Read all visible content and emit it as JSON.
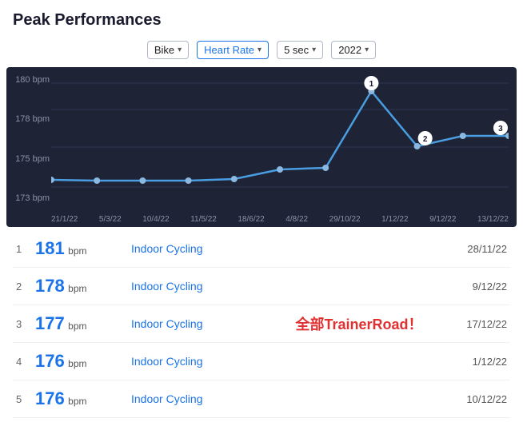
{
  "title": "Peak Performances",
  "filters": [
    {
      "label": "Bike",
      "active": false
    },
    {
      "label": "Heart Rate",
      "active": true
    },
    {
      "label": "5 sec",
      "active": false
    },
    {
      "label": "2022",
      "active": false
    }
  ],
  "chart": {
    "yLabels": [
      "180 bpm",
      "178 bpm",
      "175 bpm",
      "173 bpm"
    ],
    "xLabels": [
      "21/1/22",
      "5/3/22",
      "10/4/22",
      "11/5/22",
      "18/6/22",
      "4/8/22",
      "29/10/22",
      "1/12/22",
      "9/12/22",
      "13/12/22"
    ]
  },
  "performances": [
    {
      "rank": 1,
      "value": "181",
      "unit": "bpm",
      "activity": "Indoor Cycling",
      "date": "28/11/22"
    },
    {
      "rank": 2,
      "value": "178",
      "unit": "bpm",
      "activity": "Indoor Cycling",
      "date": "9/12/22"
    },
    {
      "rank": 3,
      "value": "177",
      "unit": "bpm",
      "activity": "Indoor Cycling",
      "overlay": "全部TrainerRoad！",
      "date": "17/12/22"
    },
    {
      "rank": 4,
      "value": "176",
      "unit": "bpm",
      "activity": "Indoor Cycling",
      "date": "1/12/22"
    },
    {
      "rank": 5,
      "value": "176",
      "unit": "bpm",
      "activity": "Indoor Cycling",
      "date": "10/12/22"
    }
  ]
}
